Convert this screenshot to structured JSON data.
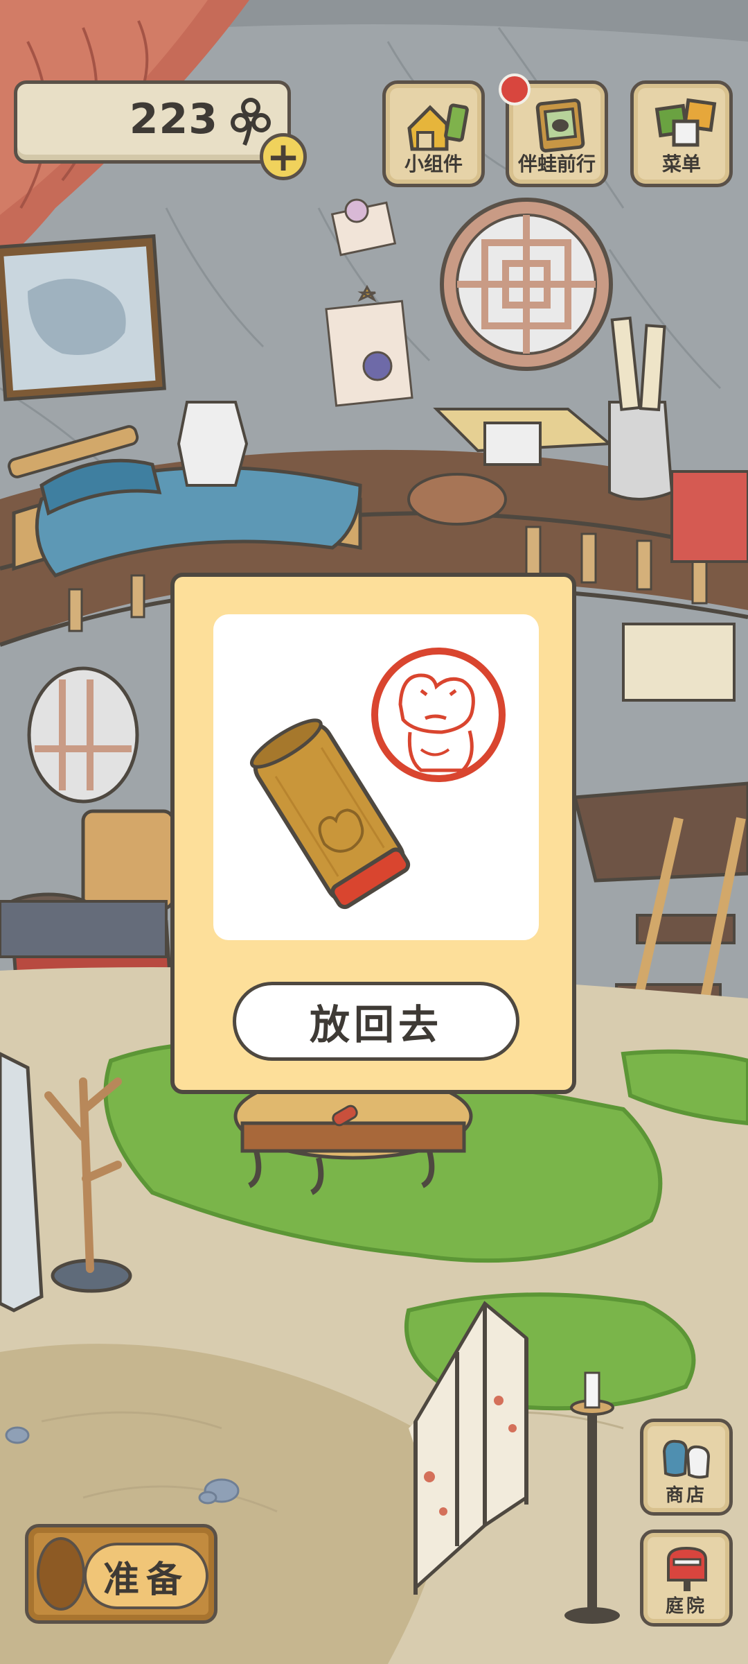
{
  "hud": {
    "clover_count": "223",
    "clover_icon": "clover-icon",
    "add_icon": "+"
  },
  "top_menu": [
    {
      "label": "小组件",
      "icon": "widget-icon"
    },
    {
      "label": "伴蛙前行",
      "icon": "album-icon",
      "has_notification": true
    },
    {
      "label": "菜单",
      "icon": "menu-cards-icon"
    }
  ],
  "modal": {
    "item_image": "frog-seal-stamp",
    "button_label": "放回去"
  },
  "bottom": {
    "prepare_label": "准备",
    "shop_label": "商店",
    "yard_label": "庭院"
  },
  "colors": {
    "modal_bg": "#fddf9a",
    "stamp_red": "#d9452f",
    "notify_red": "#d8463e",
    "button_wood": "#e6d3a8",
    "outline": "#4e4840"
  }
}
